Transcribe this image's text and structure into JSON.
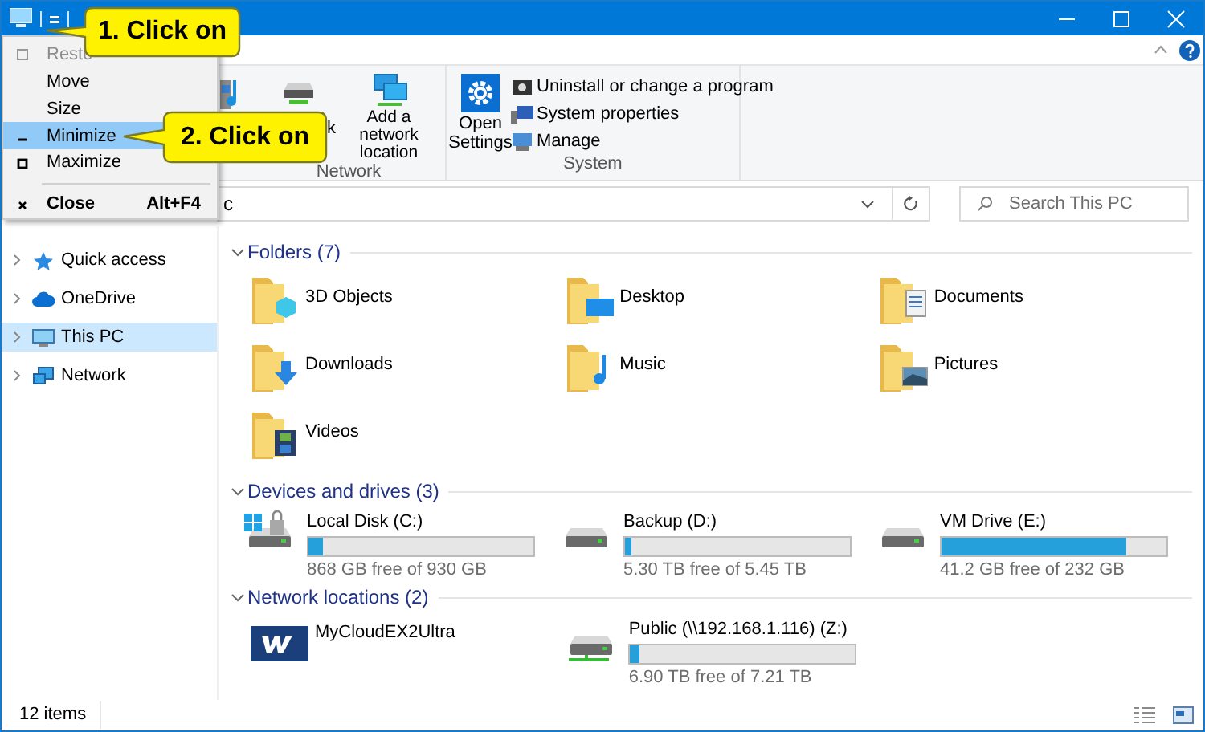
{
  "callouts": [
    {
      "text": "1. Click on"
    },
    {
      "text": "2. Click on"
    }
  ],
  "system_menu": {
    "items": [
      {
        "label": "Resto",
        "disabled": true,
        "selected": false
      },
      {
        "label": "Move",
        "disabled": false,
        "selected": false
      },
      {
        "label": "Size",
        "disabled": false,
        "selected": false
      },
      {
        "label": "Minimize",
        "disabled": false,
        "selected": true
      },
      {
        "label": "Maximize",
        "disabled": false,
        "selected": false
      },
      {
        "label": "Close",
        "shortcut": "Alt+F4",
        "disabled": false,
        "selected": false
      }
    ]
  },
  "ribbon": {
    "groups": [
      {
        "label": "Network",
        "items": [
          {
            "label": "k"
          },
          {
            "label": "Add a network location"
          }
        ]
      },
      {
        "label": "System",
        "large": {
          "label": "Open Settings"
        },
        "items": [
          {
            "label": "Uninstall or change a program"
          },
          {
            "label": "System properties"
          },
          {
            "label": "Manage"
          }
        ]
      }
    ]
  },
  "address_bar": {
    "value": "c"
  },
  "search": {
    "placeholder": "Search This PC"
  },
  "navigation": {
    "items": [
      {
        "label": "Quick access",
        "selected": false
      },
      {
        "label": "OneDrive",
        "selected": false
      },
      {
        "label": "This PC",
        "selected": true
      },
      {
        "label": "Network",
        "selected": false
      }
    ]
  },
  "folders": {
    "header": "Folders (7)",
    "items": [
      {
        "name": "3D Objects"
      },
      {
        "name": "Desktop"
      },
      {
        "name": "Documents"
      },
      {
        "name": "Downloads"
      },
      {
        "name": "Music"
      },
      {
        "name": "Pictures"
      },
      {
        "name": "Videos"
      }
    ]
  },
  "drives": {
    "header": "Devices and drives (3)",
    "items": [
      {
        "name": "Local Disk (C:)",
        "level": 0.067,
        "free": "868 GB free of 930 GB"
      },
      {
        "name": "Backup (D:)",
        "level": 0.028,
        "free": "5.30 TB free of 5.45 TB"
      },
      {
        "name": "VM Drive (E:)",
        "level": 0.822,
        "free": "41.2 GB free of 232 GB"
      }
    ]
  },
  "network_locations": {
    "header": "Network locations (2)",
    "items": [
      {
        "kind": "device",
        "name": "MyCloudEX2Ultra"
      },
      {
        "kind": "drive",
        "name": "Public (\\\\192.168.1.116) (Z:)",
        "level": 0.043,
        "free": "6.90 TB free of 7.21 TB"
      }
    ]
  },
  "status_bar": {
    "text": "12 items"
  }
}
